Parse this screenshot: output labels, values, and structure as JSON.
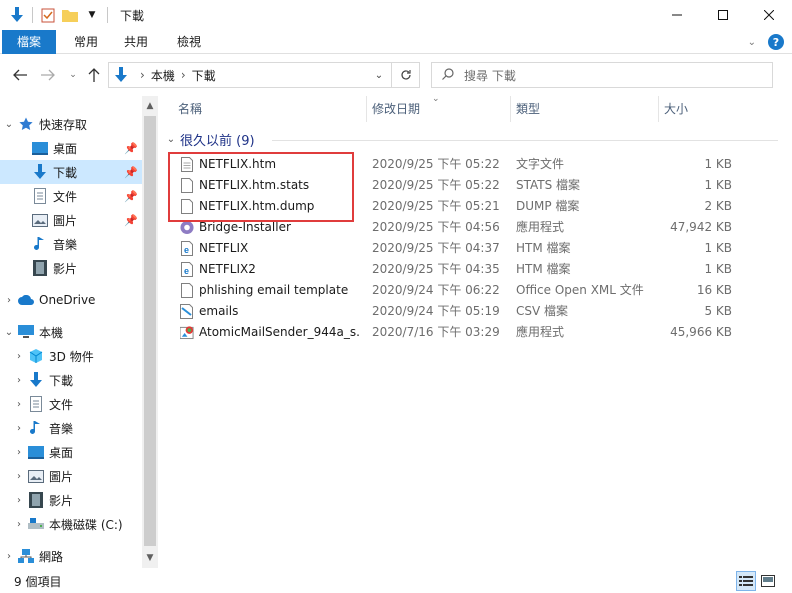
{
  "window": {
    "title": "下載"
  },
  "ribbon": {
    "tabs": [
      {
        "label": "檔案"
      },
      {
        "label": "常用"
      },
      {
        "label": "共用"
      },
      {
        "label": "檢視"
      }
    ]
  },
  "address": {
    "crumbs": [
      "本機",
      "下載"
    ],
    "search_placeholder": "搜尋 下載"
  },
  "sidebar": {
    "quick_access": "快速存取",
    "quick_items": [
      {
        "label": "桌面",
        "icon": "desktop-icon"
      },
      {
        "label": "下載",
        "icon": "download-icon"
      },
      {
        "label": "文件",
        "icon": "document-icon"
      },
      {
        "label": "圖片",
        "icon": "picture-icon"
      },
      {
        "label": "音樂",
        "icon": "music-icon"
      },
      {
        "label": "影片",
        "icon": "video-icon"
      }
    ],
    "onedrive": "OneDrive",
    "this_pc": "本機",
    "pc_items": [
      {
        "label": "3D 物件",
        "icon": "3d-objects-icon"
      },
      {
        "label": "下載",
        "icon": "download-icon"
      },
      {
        "label": "文件",
        "icon": "document-icon"
      },
      {
        "label": "音樂",
        "icon": "music-icon"
      },
      {
        "label": "桌面",
        "icon": "desktop-icon"
      },
      {
        "label": "圖片",
        "icon": "picture-icon"
      },
      {
        "label": "影片",
        "icon": "video-icon"
      },
      {
        "label": "本機磁碟 (C:)",
        "icon": "drive-icon"
      }
    ],
    "network": "網路"
  },
  "list": {
    "columns": {
      "name": "名稱",
      "date": "修改日期",
      "type": "類型",
      "size": "大小"
    },
    "group_label": "很久以前 (9)",
    "files": [
      {
        "name": "NETFLIX.htm",
        "date": "2020/9/25 下午 05:22",
        "type": "文字文件",
        "size": "1 KB",
        "icon": "text-file-icon"
      },
      {
        "name": "NETFLIX.htm.stats",
        "date": "2020/9/25 下午 05:22",
        "type": "STATS 檔案",
        "size": "1 KB",
        "icon": "blank-file-icon"
      },
      {
        "name": "NETFLIX.htm.dump",
        "date": "2020/9/25 下午 05:21",
        "type": "DUMP 檔案",
        "size": "2 KB",
        "icon": "blank-file-icon"
      },
      {
        "name": "Bridge-Installer",
        "date": "2020/9/25 下午 04:56",
        "type": "應用程式",
        "size": "47,942 KB",
        "icon": "installer-app-icon"
      },
      {
        "name": "NETFLIX",
        "date": "2020/9/25 下午 04:37",
        "type": "HTM 檔案",
        "size": "1 KB",
        "icon": "edge-htm-icon"
      },
      {
        "name": "NETFLIX2",
        "date": "2020/9/25 下午 04:35",
        "type": "HTM 檔案",
        "size": "1 KB",
        "icon": "edge-htm-icon"
      },
      {
        "name": "phlishing email template",
        "date": "2020/9/24 下午 06:22",
        "type": "Office Open XML 文件",
        "size": "16 KB",
        "icon": "blank-file-icon"
      },
      {
        "name": "emails",
        "date": "2020/9/24 下午 05:19",
        "type": "CSV 檔案",
        "size": "5 KB",
        "icon": "csv-file-icon"
      },
      {
        "name": "AtomicMailSender_944a_s...",
        "date": "2020/7/16 下午 03:29",
        "type": "應用程式",
        "size": "45,966 KB",
        "icon": "atomic-app-icon"
      }
    ]
  },
  "status": {
    "item_count": "9 個項目"
  },
  "colors": {
    "accent": "#1979ca",
    "selection": "#cce8ff",
    "highlight_box": "#e03c3c",
    "group_text": "#1e3287"
  }
}
